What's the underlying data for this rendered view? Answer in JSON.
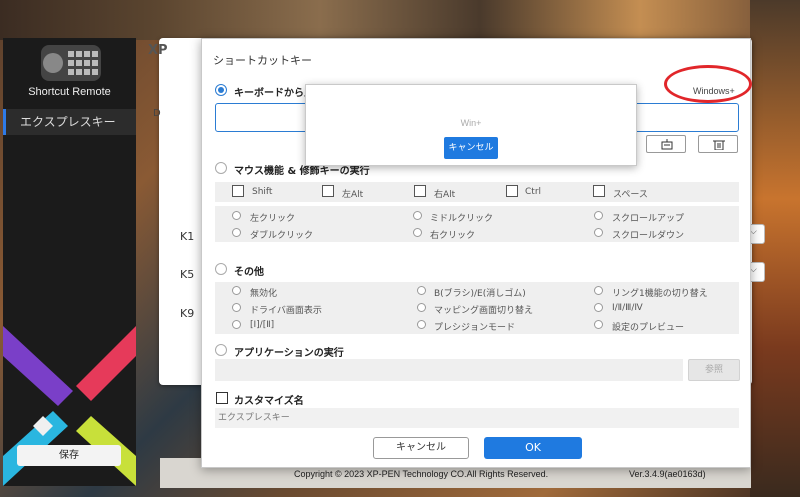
{
  "sidebar": {
    "app_title": "Shortcut Remote",
    "active_item": "エクスプレスキー",
    "save_label": "保存"
  },
  "panel": {
    "logo_text": "XP",
    "d_label": "D",
    "keys": [
      "K1",
      "K5",
      "K9"
    ]
  },
  "footer": {
    "copyright": "Copyright © 2023  XP-PEN Technology CO.All Rights Reserved.",
    "version": "Ver.3.4.9(ae0163d)"
  },
  "dialog": {
    "title": "ショートカットキー",
    "keyboard_section": "キーボードから入力",
    "key_preview": "Windows+",
    "mouse_section": "マウス機能 & 修飾キーの実行",
    "modifiers": [
      "Shift",
      "左Alt",
      "右Alt",
      "Ctrl",
      "スペース"
    ],
    "mouse_actions": [
      [
        "左クリック",
        "ミドルクリック",
        "スクロールアップ"
      ],
      [
        "ダブルクリック",
        "右クリック",
        "スクロールダウン"
      ]
    ],
    "other_section": "その他",
    "other_actions": [
      [
        "無効化",
        "B(ブラシ)/E(消しゴム)",
        "リング1機能の切り替え"
      ],
      [
        "ドライバ画面表示",
        "マッピング画面切り替え",
        "Ⅰ/Ⅱ/Ⅲ/Ⅳ"
      ],
      [
        "[Ⅰ]/[Ⅱ]",
        "プレシジョンモード",
        "設定のプレビュー"
      ]
    ],
    "app_section": "アプリケーションの実行",
    "browse_label": "参照",
    "custom_name_label": "カスタマイズ名",
    "custom_name_value": "エクスプレスキー",
    "cancel_label": "キャンセル",
    "ok_label": "OK"
  },
  "popup": {
    "text": "Win+",
    "cancel_label": "キャンセル"
  },
  "colors": {
    "accent": "#1f7ae0",
    "annotation_red": "#e1262a",
    "sidebar_bg": "#1b1b1b"
  }
}
